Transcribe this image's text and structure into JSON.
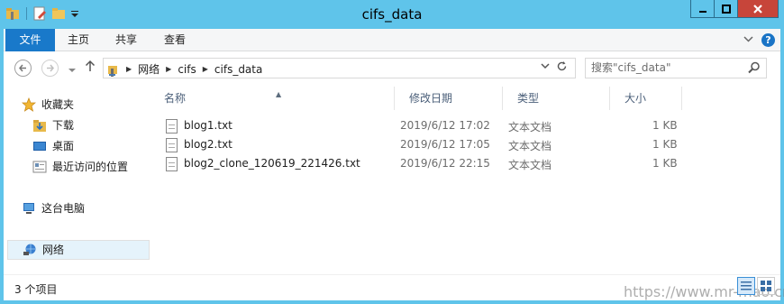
{
  "window": {
    "title": "cifs_data"
  },
  "ribbon": {
    "tabs": [
      {
        "label": "文件"
      },
      {
        "label": "主页"
      },
      {
        "label": "共享"
      },
      {
        "label": "查看"
      }
    ]
  },
  "address": {
    "crumbs": [
      "网络",
      "cifs",
      "cifs_data"
    ]
  },
  "search": {
    "placeholder": "搜索\"cifs_data\""
  },
  "sidebar": {
    "items": [
      {
        "label": "收藏夹",
        "icon": "star-icon"
      },
      {
        "label": "下载",
        "icon": "download-folder-icon"
      },
      {
        "label": "桌面",
        "icon": "desktop-icon"
      },
      {
        "label": "最近访问的位置",
        "icon": "recent-places-icon"
      },
      {
        "label": "这台电脑",
        "icon": "computer-icon"
      },
      {
        "label": "网络",
        "icon": "network-icon"
      }
    ]
  },
  "columns": {
    "name": "名称",
    "date": "修改日期",
    "type": "类型",
    "size": "大小"
  },
  "files": [
    {
      "name": "blog1.txt",
      "date": "2019/6/12 17:02",
      "type": "文本文档",
      "size": "1 KB"
    },
    {
      "name": "blog2.txt",
      "date": "2019/6/12 17:05",
      "type": "文本文档",
      "size": "1 KB"
    },
    {
      "name": "blog2_clone_120619_221426.txt",
      "date": "2019/6/12 22:15",
      "type": "文本文档",
      "size": "1 KB"
    }
  ],
  "status": {
    "count": "3 个项目",
    "watermark": "https://www.mr-mao.cn"
  },
  "colors": {
    "titlebar": "#5fc4ea",
    "file_tab": "#1979ca",
    "close_button": "#c7453a"
  }
}
